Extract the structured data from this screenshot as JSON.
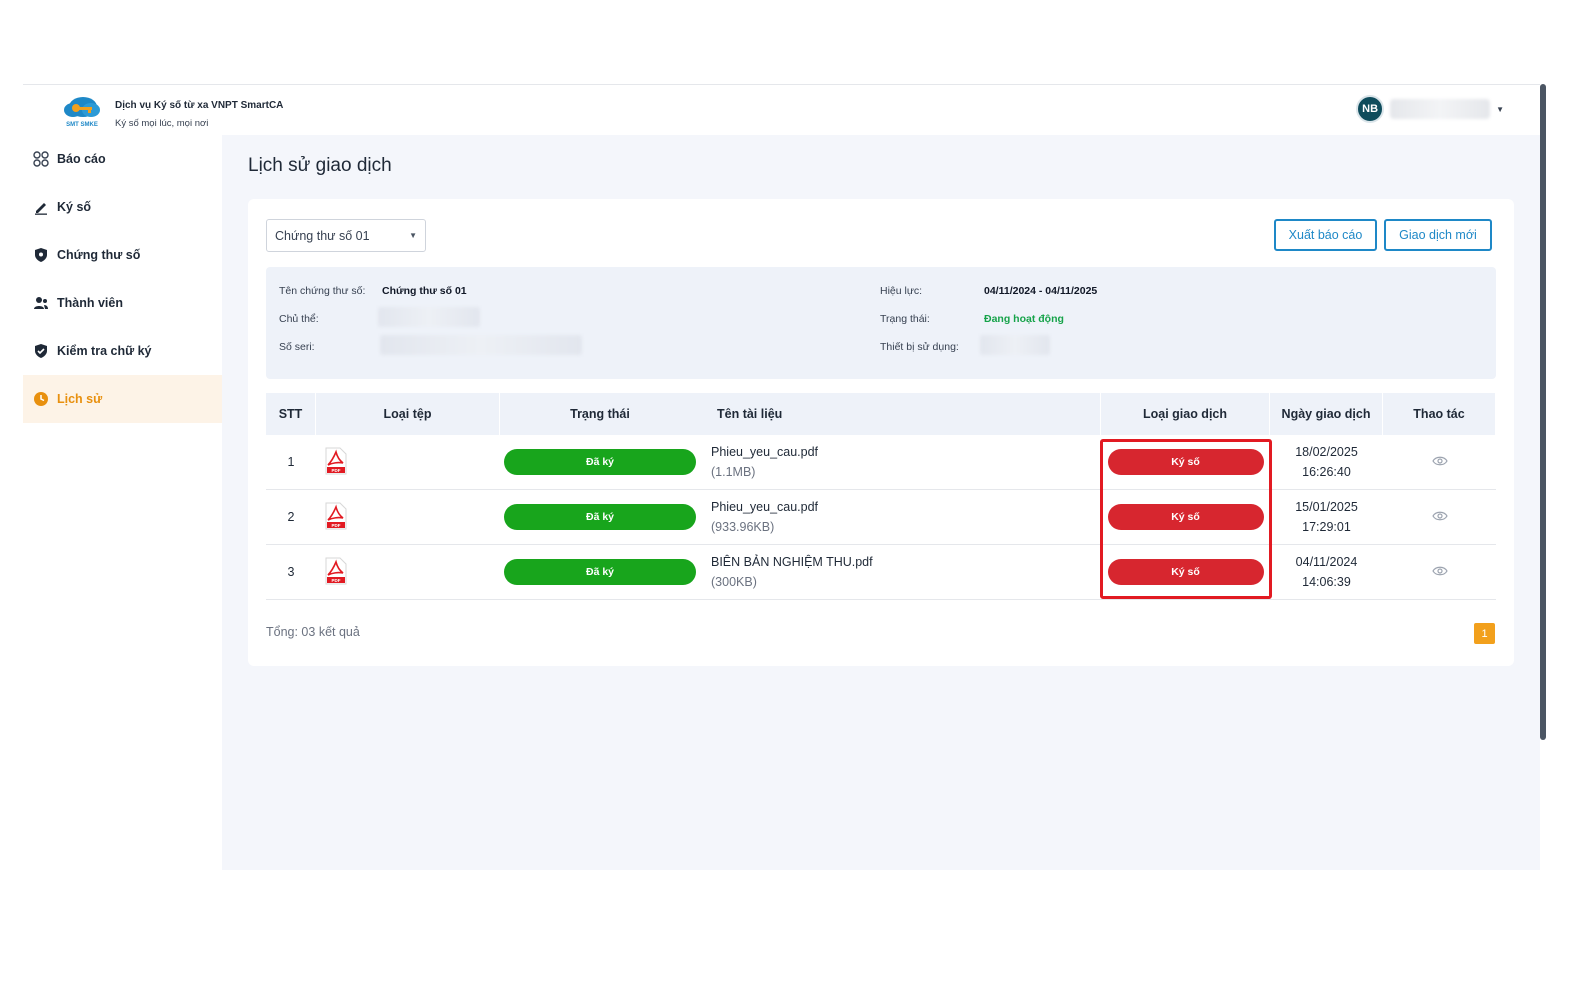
{
  "app": {
    "title": "Dịch vụ Ký số từ xa VNPT SmartCA",
    "subtitle": "Ký số mọi lúc, mọi nơi",
    "user_initials": "NB"
  },
  "sidebar": {
    "items": [
      {
        "label": "Báo cáo",
        "icon": "grid-icon",
        "active": false
      },
      {
        "label": "Ký số",
        "icon": "pen-icon",
        "active": false
      },
      {
        "label": "Chứng thư số",
        "icon": "shield-icon",
        "active": false
      },
      {
        "label": "Thành viên",
        "icon": "users-icon",
        "active": false
      },
      {
        "label": "Kiểm tra chữ ký",
        "icon": "shield-check-icon",
        "active": false
      },
      {
        "label": "Lịch sử",
        "icon": "clock-icon",
        "active": true
      }
    ]
  },
  "page": {
    "title": "Lịch sử giao dịch",
    "certificate_select": "Chứng thư số 01",
    "export_button": "Xuất báo cáo",
    "new_button": "Giao dịch mới"
  },
  "info": {
    "name_label": "Tên chứng thư số:",
    "name_value": "Chứng thư số 01",
    "subject_label": "Chủ thể:",
    "serial_label": "Số seri:",
    "validity_label": "Hiệu lực:",
    "validity_value": "04/11/2024 - 04/11/2025",
    "status_label": "Trạng thái:",
    "status_value": "Đang hoạt động",
    "device_label": "Thiết bị sử dụng:"
  },
  "table": {
    "headers": {
      "stt": "STT",
      "file_type": "Loại tệp",
      "status": "Trạng thái",
      "doc_name": "Tên tài liệu",
      "tx_type": "Loại giao dịch",
      "tx_date": "Ngày giao dịch",
      "actions": "Thao tác"
    },
    "rows": [
      {
        "stt": "1",
        "file_icon": "pdf-icon",
        "status": "Đã ký",
        "name": "Phieu_yeu_cau.pdf",
        "size": "(1.1MB)",
        "tx_type": "Ký số",
        "date": "18/02/2025",
        "time": "16:26:40"
      },
      {
        "stt": "2",
        "file_icon": "pdf-icon",
        "status": "Đã ký",
        "name": "Phieu_yeu_cau.pdf",
        "size": "(933.96KB)",
        "tx_type": "Ký số",
        "date": "15/01/2025",
        "time": "17:29:01"
      },
      {
        "stt": "3",
        "file_icon": "pdf-icon",
        "status": "Đã ký",
        "name": "BIÊN BẢN NGHIỆM THU.pdf",
        "size": "(300KB)",
        "tx_type": "Ký số",
        "date": "04/11/2024",
        "time": "14:06:39"
      }
    ],
    "total": "Tổng: 03 kết quả",
    "current_page": "1"
  },
  "colors": {
    "accent": "#1e88c7",
    "active_nav": "#e8900f",
    "signed_green": "#18a51c",
    "tx_red": "#d7262f",
    "highlight": "#e21a22"
  }
}
